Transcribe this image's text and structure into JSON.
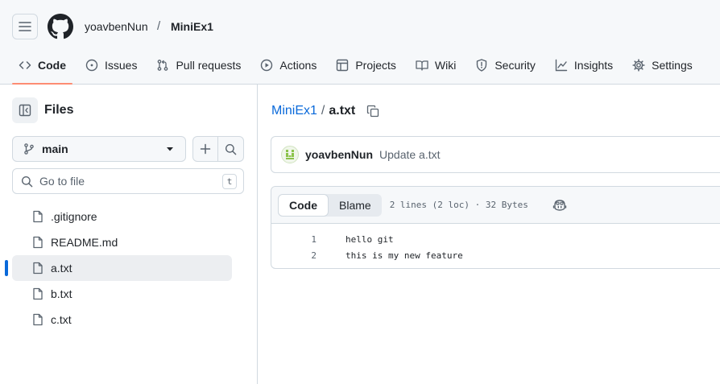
{
  "header": {
    "owner": "yoavbenNun",
    "separator": "/",
    "repo": "MiniEx1"
  },
  "nav": {
    "tabs": [
      {
        "label": "Code",
        "icon": "code-icon",
        "active": true
      },
      {
        "label": "Issues",
        "icon": "issue-icon"
      },
      {
        "label": "Pull requests",
        "icon": "pull-request-icon"
      },
      {
        "label": "Actions",
        "icon": "play-icon"
      },
      {
        "label": "Projects",
        "icon": "table-icon"
      },
      {
        "label": "Wiki",
        "icon": "book-icon"
      },
      {
        "label": "Security",
        "icon": "shield-icon"
      },
      {
        "label": "Insights",
        "icon": "graph-icon"
      },
      {
        "label": "Settings",
        "icon": "gear-icon"
      }
    ]
  },
  "sidebar": {
    "title": "Files",
    "branch": "main",
    "search_placeholder": "Go to file",
    "shortcut": "t",
    "files": [
      {
        "name": ".gitignore"
      },
      {
        "name": "README.md"
      },
      {
        "name": "a.txt",
        "selected": true
      },
      {
        "name": "b.txt"
      },
      {
        "name": "c.txt"
      }
    ]
  },
  "main": {
    "path_repo": "MiniEx1",
    "path_sep": "/",
    "path_file": "a.txt",
    "commit": {
      "author": "yoavbenNun",
      "message": "Update a.txt"
    },
    "file_view": {
      "tab_code": "Code",
      "tab_blame": "Blame",
      "info": "2 lines (2 loc) · 32 Bytes",
      "lines": [
        {
          "num": "1",
          "text": "hello git"
        },
        {
          "num": "2",
          "text": "this is my new feature"
        }
      ]
    }
  },
  "colors": {
    "accent_blue": "#0969da",
    "tab_underline": "#fd8c73",
    "border": "#d1d9e0"
  }
}
